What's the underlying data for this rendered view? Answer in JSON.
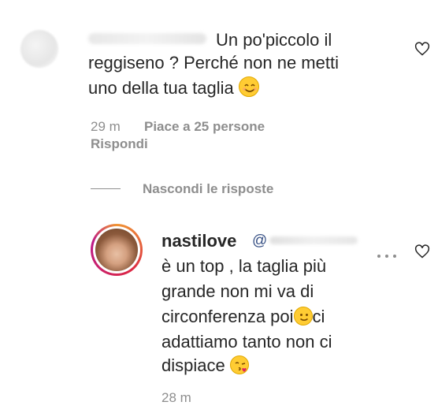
{
  "comment1": {
    "text_line1": "Un po'piccolo il",
    "text_line2": "reggiseno ? Perché non ne metti",
    "text_line3": "uno della tua taglia",
    "time": "29 m",
    "likes": "Piace a 25 persone",
    "reply": "Rispondi"
  },
  "replies_toggle": "Nascondi le risposte",
  "reply1": {
    "username": "nastilove",
    "line1": "è un top , la taglia più",
    "line2": "grande non mi va di",
    "line3": "circonferenza poi",
    "line3b": "ci",
    "line4": "adattiamo tanto non ci",
    "line5": "dispiace",
    "time": "28 m"
  },
  "icons": {
    "heart": "heart-outline-icon",
    "more": "more-dots-icon",
    "smile": "smiling-face-emoji",
    "slight_smile": "slightly-smiling-face-emoji",
    "kiss": "face-blowing-kiss-emoji"
  },
  "colors": {
    "text": "#262626",
    "muted": "#8e8e8e",
    "story_ring": "#dc2743"
  }
}
